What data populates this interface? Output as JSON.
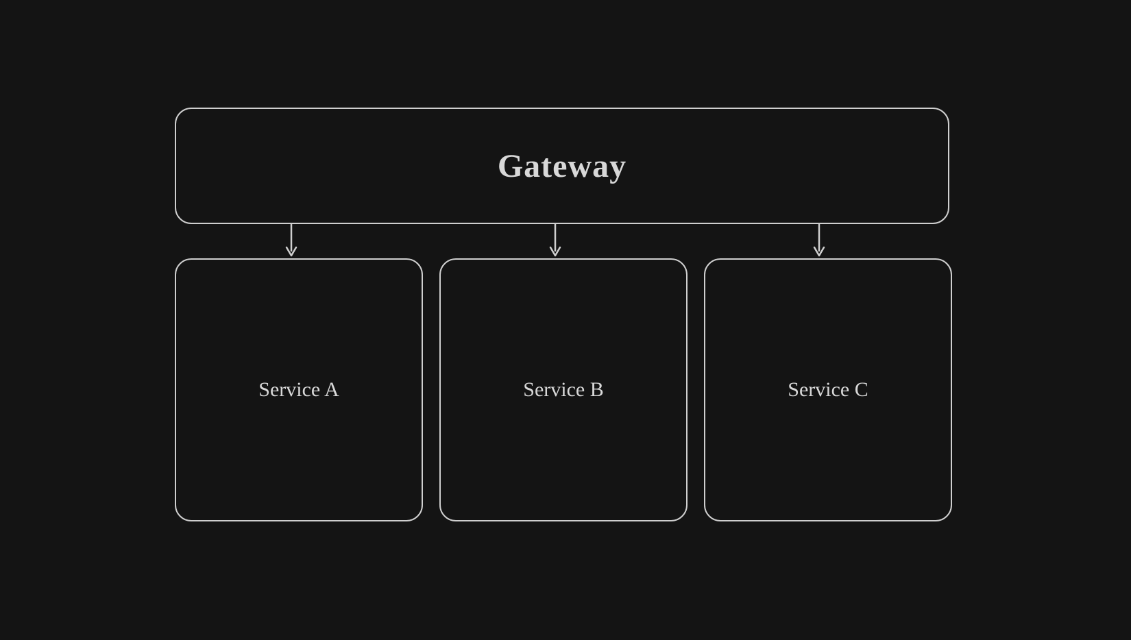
{
  "diagram": {
    "gateway": {
      "label": "Gateway"
    },
    "services": [
      {
        "label": "Service A"
      },
      {
        "label": "Service B"
      },
      {
        "label": "Service C"
      }
    ],
    "colors": {
      "background": "#141414",
      "stroke": "#cfcfcf",
      "text": "#d8d8d8"
    }
  }
}
